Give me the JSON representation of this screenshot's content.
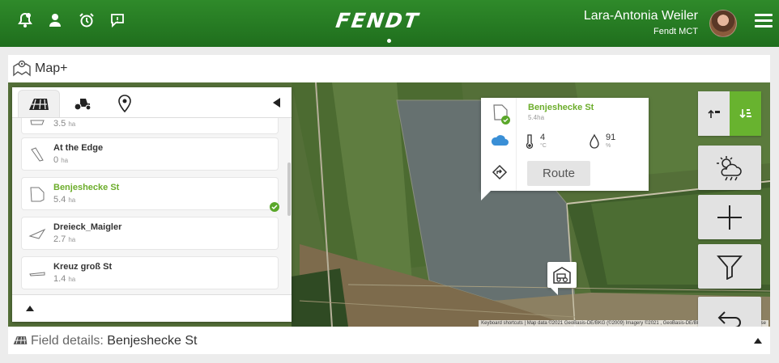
{
  "header": {
    "brand": "FENDT",
    "user_name": "Lara-Antonia Weiler",
    "organization": "Fendt MCT",
    "icons": [
      "notification-icon",
      "user-icon",
      "alarm-clock-icon",
      "feedback-icon"
    ],
    "brand_color": "#2a7f26"
  },
  "map_section": {
    "title": "Map+",
    "attribution": "Keyboard shortcuts | Map data ©2021 GeoBasis-DE/BKG (©2009) Imagery ©2021 , GeoBasis-DE/BKG, GeoContent, Maxar Te... se"
  },
  "panel": {
    "tabs": [
      "fields-icon",
      "tractor-icon",
      "location-pin-icon"
    ],
    "active_tab": 0,
    "fields": [
      {
        "name": "",
        "area": "3.5",
        "unit": "ha",
        "selected": false
      },
      {
        "name": "At the Edge",
        "area": "0",
        "unit": "ha",
        "selected": false
      },
      {
        "name": "Benjeshecke St",
        "area": "5.4",
        "unit": "ha",
        "selected": true
      },
      {
        "name": "Dreieck_Maigler",
        "area": "2.7",
        "unit": "ha",
        "selected": false
      },
      {
        "name": "Kreuz groß St",
        "area": "1.4",
        "unit": "ha",
        "selected": false
      }
    ]
  },
  "popup": {
    "field_name": "Benjeshecke St",
    "area": "5.4ha",
    "temperature": "4",
    "temperature_unit": "°C",
    "humidity": "91",
    "humidity_unit": "%",
    "route_label": "Route"
  },
  "details": {
    "label": "Field details:",
    "value": "Benjeshecke St"
  },
  "colors": {
    "accent_green": "#6cad2b",
    "toggle_active": "#68b32f",
    "weather_blue": "#3a8fd6"
  }
}
